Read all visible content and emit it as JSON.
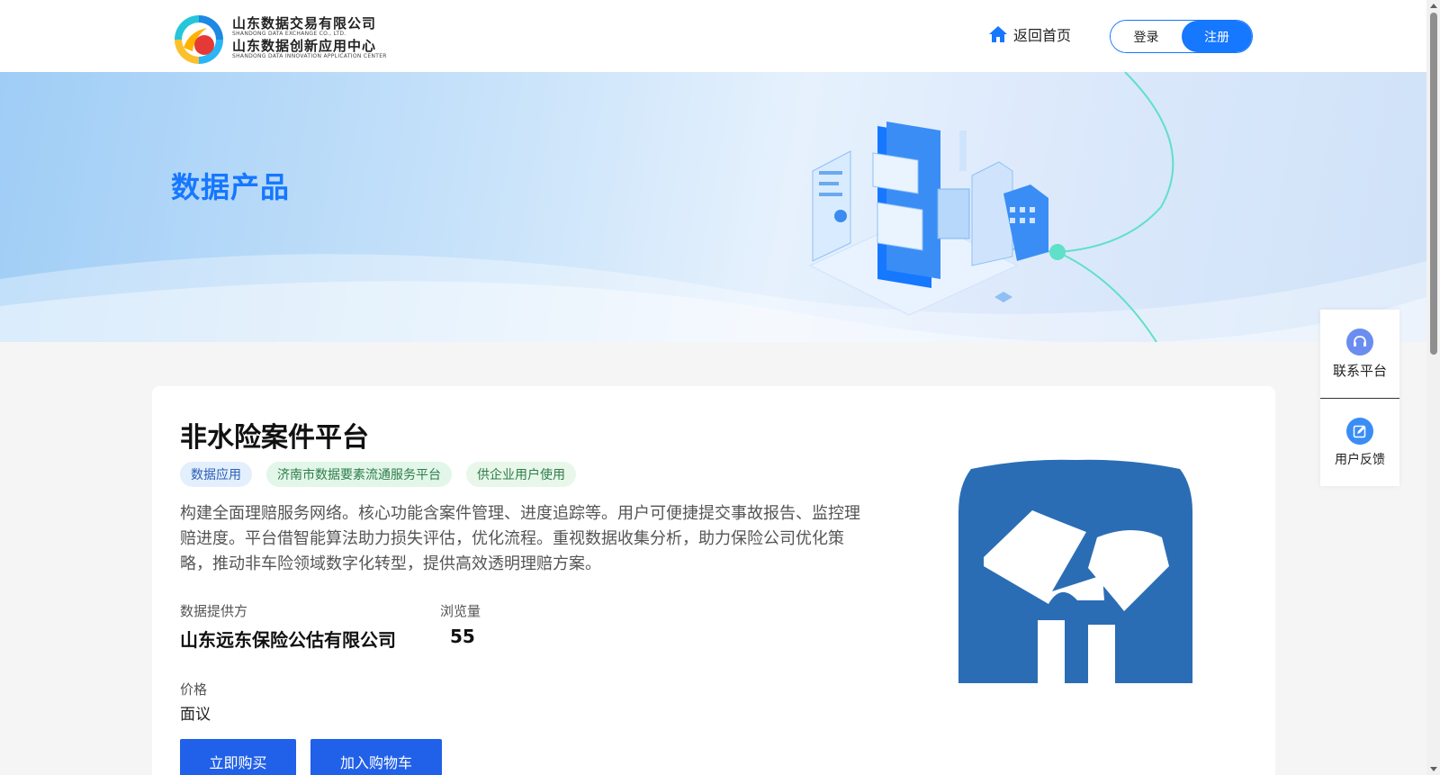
{
  "header": {
    "logo": {
      "line1": "山东数据交易有限公司",
      "line1_en": "SHANDONG DATA EXCHANGE CO., LTD.",
      "line2": "山东数据创新应用中心",
      "line2_en": "SHANDONG DATA INNOVATION APPLICATION CENTER"
    },
    "home_link": "返回首页",
    "login": "登录",
    "register": "注册"
  },
  "banner": {
    "title": "数据产品"
  },
  "product": {
    "title": "非水险案件平台",
    "tags": [
      "数据应用",
      "济南市数据要素流通服务平台",
      "供企业用户使用"
    ],
    "description": "构建全面理赔服务网络。核心功能含案件管理、进度追踪等。用户可便捷提交事故报告、监控理赔进度。平台借智能算法助力损失评估，优化流程。重视数据收集分析，助力保险公司优化策略，推动非车险领域数字化转型，提供高效透明理赔方案。",
    "provider_label": "数据提供方",
    "provider": "山东远东保险公估有限公司",
    "views_label": "浏览量",
    "views": "55",
    "price_label": "价格",
    "price": "面议",
    "buy_button": "立即购买",
    "cart_button": "加入购物车"
  },
  "side_panel": {
    "contact": "联系平台",
    "feedback": "用户反馈"
  },
  "colors": {
    "primary": "#1677ff",
    "button": "#2160e8",
    "shield": "#2a6db5"
  }
}
